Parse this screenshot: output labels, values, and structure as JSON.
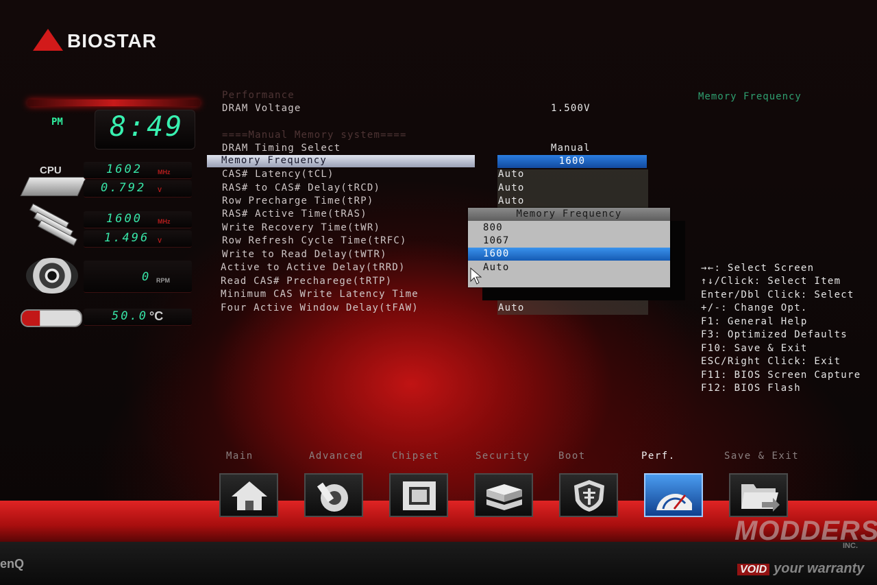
{
  "brand": {
    "logo_text": "BIOSTAR"
  },
  "monitor": {
    "ampm": "PM",
    "time": "8:49",
    "cpu_label": "CPU",
    "cpu_freq": "1602",
    "cpu_freq_unit": "MHz",
    "cpu_volt": "0.792",
    "cpu_volt_unit": "V",
    "mem_freq": "1600",
    "mem_freq_unit": "MHz",
    "mem_volt": "1.496",
    "mem_volt_unit": "V",
    "fan_speed": "0",
    "fan_unit": "RPM",
    "temp": "50.0",
    "temp_unit": "°C"
  },
  "settings": {
    "section_perf": "Performance",
    "dram_voltage_label": "DRAM Voltage",
    "dram_voltage_value": "1.500V",
    "section_manual": "====Manual Memory system====",
    "dram_timing_label": "DRAM Timing Select",
    "dram_timing_value": "Manual",
    "memory_frequency_label": "Memory Frequency",
    "memory_frequency_value": "1600",
    "items": [
      {
        "label": "CAS# Latency(tCL)",
        "value": "Auto"
      },
      {
        "label": "RAS# to CAS# Delay(tRCD)",
        "value": "Auto"
      },
      {
        "label": "Row Precharge Time(tRP)",
        "value": "Auto"
      },
      {
        "label": "RAS# Active Time(tRAS)",
        "value": ""
      },
      {
        "label": "Write Recovery Time(tWR)",
        "value": ""
      },
      {
        "label": "Row Refresh Cycle Time(tRFC)",
        "value": ""
      },
      {
        "label": "Write to Read Delay(tWTR)",
        "value": ""
      },
      {
        "label": "Active to Active Delay(tRRD)",
        "value": ""
      },
      {
        "label": "Read CAS# Precharege(tRTP)",
        "value": ""
      },
      {
        "label": "Minimum CAS Write Latency Time",
        "value": ""
      },
      {
        "label": "Four Active Window Delay(tFAW)",
        "value": "Auto"
      }
    ]
  },
  "popup": {
    "title": "Memory Frequency",
    "options": [
      "800",
      "1067",
      "1600",
      "Auto"
    ],
    "selected": "1600"
  },
  "help": {
    "title": "Memory Frequency",
    "lines": [
      "→←: Select Screen",
      "↑↓/Click: Select Item",
      "Enter/Dbl Click: Select",
      "+/-: Change Opt.",
      "F1: General Help",
      "F3: Optimized Defaults",
      "F10: Save & Exit",
      "ESC/Right Click: Exit",
      "F11: BIOS Screen Capture",
      "F12: BIOS Flash"
    ]
  },
  "tabs": [
    {
      "label": "Main",
      "icon": "home-icon"
    },
    {
      "label": "Advanced",
      "icon": "joystick-icon"
    },
    {
      "label": "Chipset",
      "icon": "chip-icon"
    },
    {
      "label": "Security",
      "icon": "drives-icon"
    },
    {
      "label": "Boot",
      "icon": "shield-icon"
    },
    {
      "label": "Perf.",
      "icon": "speedometer-icon",
      "active": true
    },
    {
      "label": "Save & Exit",
      "icon": "folder-exit-icon"
    }
  ],
  "bezel": {
    "brand": "enQ"
  },
  "watermark": {
    "line1": "MODDERS",
    "line2": "INC.",
    "void": "VOID",
    "line3": "your warranty"
  },
  "colors": {
    "accent_red": "#d21a1a",
    "lcd_green": "#38f0b0",
    "selection_blue": "#2a7de0",
    "help_title_green": "#2f9f70"
  }
}
